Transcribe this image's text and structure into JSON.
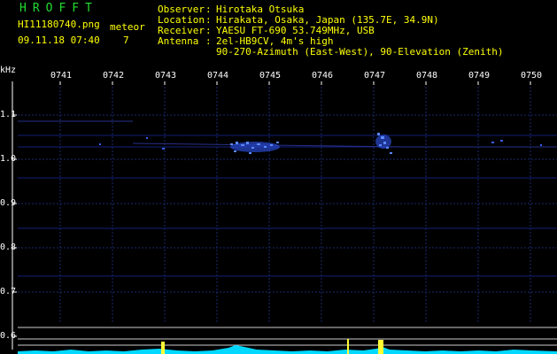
{
  "header": {
    "app_title": "HROFFT",
    "filename": "HI11180740.png",
    "timestamp": "09.11.18 07:40",
    "meteor_label": "meteor",
    "meteor_count": "7",
    "info": [
      {
        "label": "Observer",
        "value": "Hirotaka Otsuka"
      },
      {
        "label": "Location",
        "value": "Hirakata, Osaka, Japan (135.7E, 34.9N)"
      },
      {
        "label": "Receiver",
        "value": "YAESU FT-690 53.749MHz, USB"
      },
      {
        "label": "Antenna",
        "value": "2el-HB9CV, 4m's high"
      }
    ],
    "antenna_line2": "90-270-Azimuth (East-West), 90-Elevation (Zenith)"
  },
  "axis": {
    "y_unit": "kHz",
    "time_ticks": [
      "0741",
      "0742",
      "0743",
      "0744",
      "0745",
      "0746",
      "0747",
      "0748",
      "0749",
      "0750"
    ],
    "freq_ticks": [
      "1.1",
      "1.0",
      "0.9",
      "0.8",
      "0.7",
      "0.6"
    ]
  },
  "colors": {
    "background": "#000000",
    "header_text": "#ffff00",
    "title_green": "#22dd33",
    "grid": "#1a2a6e",
    "echo": "#5a88ff",
    "spectrum": "#00d8ff",
    "spike": "#ffff33"
  }
}
